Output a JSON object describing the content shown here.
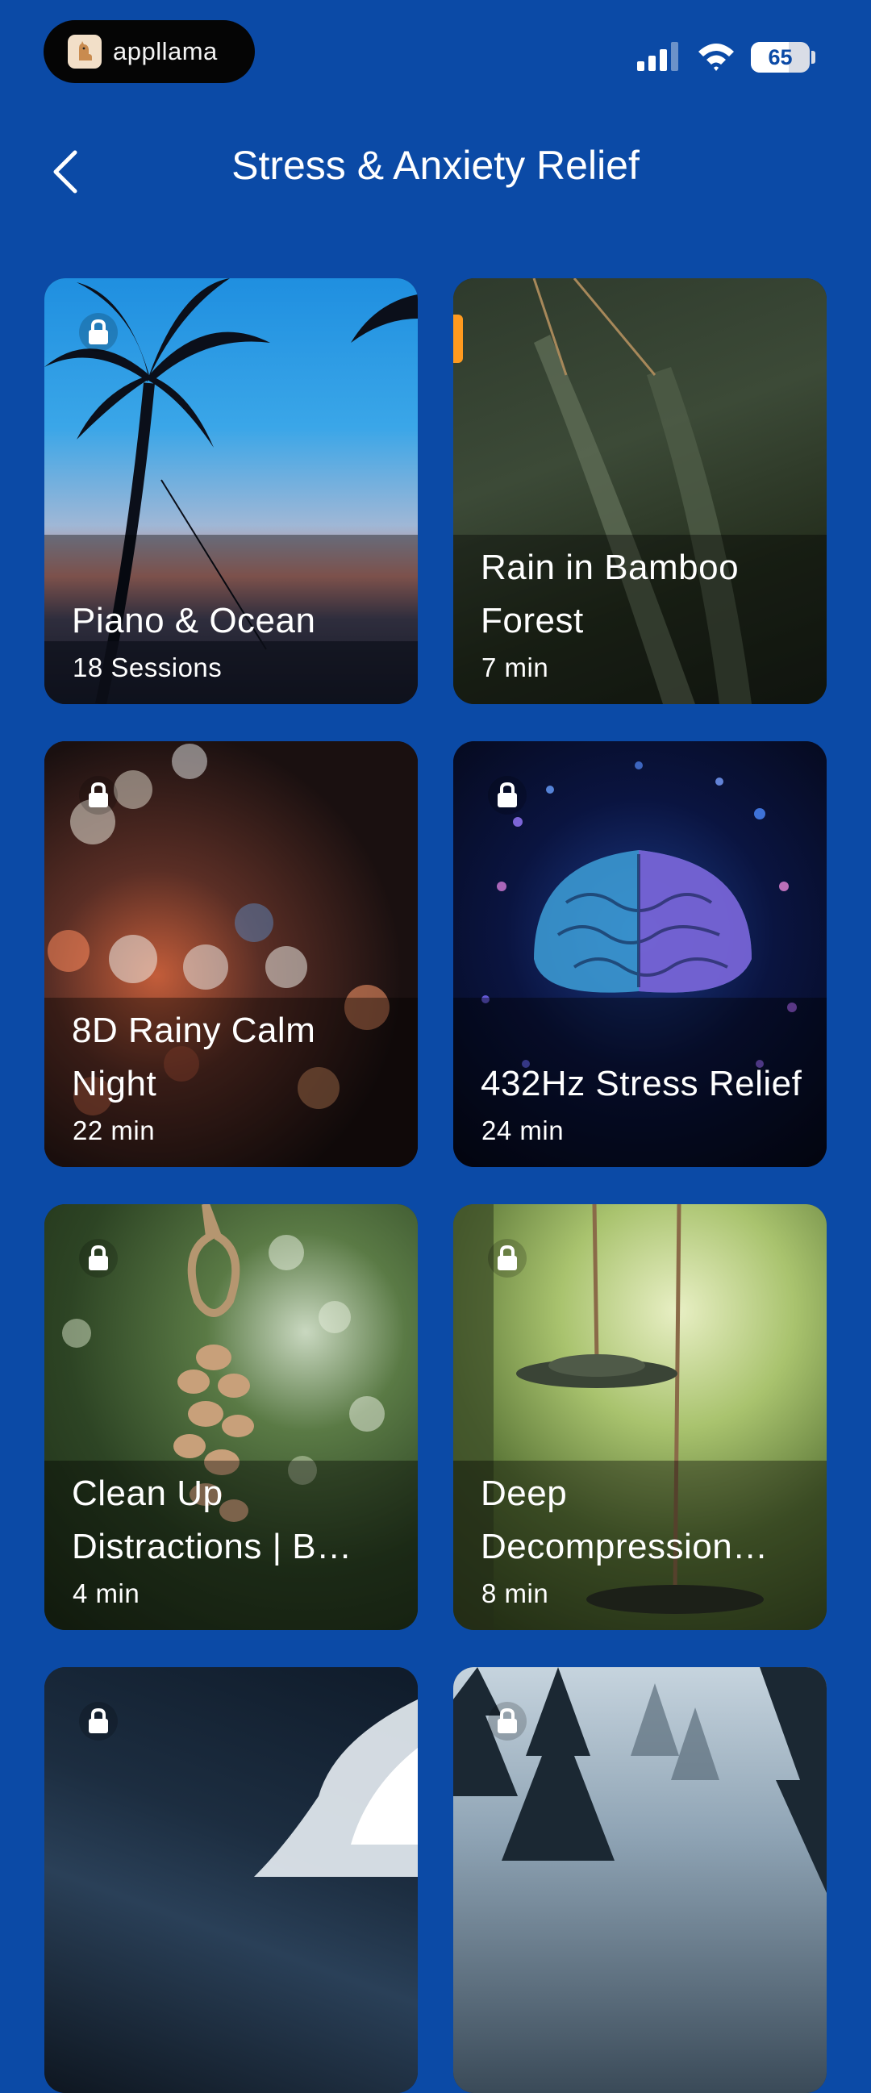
{
  "status_bar": {
    "brand_name": "appllama",
    "battery_level": "65",
    "battery_percent": 65
  },
  "header": {
    "title": "Stress & Anxiety Relief"
  },
  "cards": [
    {
      "title": "Piano & Ocean",
      "subtitle": "18 Sessions",
      "locked": true
    },
    {
      "title": "Rain in Bamboo Forest",
      "subtitle": "7 min",
      "locked": false
    },
    {
      "title": "8D Rainy Calm Night",
      "subtitle": "22 min",
      "locked": true
    },
    {
      "title": "432Hz Stress Relief",
      "subtitle": "24 min",
      "locked": true
    },
    {
      "title": "Clean Up Distractions | B…",
      "subtitle": "4 min",
      "locked": true
    },
    {
      "title": "Deep Decompression…",
      "subtitle": "8 min",
      "locked": true
    },
    {
      "title": "",
      "subtitle": "",
      "locked": true
    },
    {
      "title": "",
      "subtitle": "",
      "locked": true
    }
  ],
  "colors": {
    "background": "#0b4aa6",
    "badge": "#ff9a1f"
  }
}
